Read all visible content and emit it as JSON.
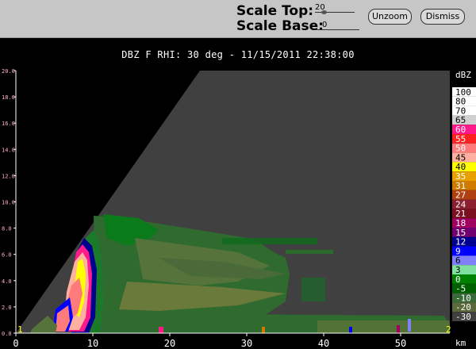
{
  "toolbar": {
    "scale_top_label": "Scale Top:",
    "scale_top_value": "20",
    "scale_base_label": "Scale Base:",
    "scale_base_value": "0",
    "unzoom_label": "Unzoom",
    "dismiss_label": "Dismiss"
  },
  "plot": {
    "title": "DBZ F  RHI: 30 deg  -  11/15/2011 22:38:00",
    "x_ticks": [
      "0",
      "10",
      "20",
      "30",
      "40",
      "50"
    ],
    "x_unit": "km",
    "y_ticks": [
      "0.0",
      "2.0",
      "4.0",
      "6.0",
      "8.0",
      "10.0",
      "12.0",
      "14.0",
      "16.0",
      "18.0",
      "20.0"
    ],
    "corner_left": "1",
    "corner_right": "2",
    "colors": {
      "background": "#404040",
      "blocked": "#000000",
      "axis_text": "#ffffff",
      "tick_y_text": "#ffb0c0"
    }
  },
  "colorbar": {
    "unit": "dBZ",
    "levels": [
      {
        "label": "100",
        "color": "#ffffff"
      },
      {
        "label": "80",
        "color": "#ffffff"
      },
      {
        "label": "70",
        "color": "#ffffff"
      },
      {
        "label": "65",
        "color": "#d0d0d0"
      },
      {
        "label": "60",
        "color": "#ff1a8c"
      },
      {
        "label": "55",
        "color": "#ff2020"
      },
      {
        "label": "50",
        "color": "#ff7a7a"
      },
      {
        "label": "45",
        "color": "#ffb0a0"
      },
      {
        "label": "40",
        "color": "#ffff00"
      },
      {
        "label": "35",
        "color": "#e8a000"
      },
      {
        "label": "31",
        "color": "#d07a00"
      },
      {
        "label": "27",
        "color": "#b04010"
      },
      {
        "label": "24",
        "color": "#8a2030"
      },
      {
        "label": "21",
        "color": "#7a1020"
      },
      {
        "label": "18",
        "color": "#a00060"
      },
      {
        "label": "15",
        "color": "#700070"
      },
      {
        "label": "12",
        "color": "#000090"
      },
      {
        "label": "9",
        "color": "#0000ff"
      },
      {
        "label": "6",
        "color": "#8080ff"
      },
      {
        "label": "3",
        "color": "#80e0a0"
      },
      {
        "label": "0",
        "color": "#008000"
      },
      {
        "label": "-5",
        "color": "#006000"
      },
      {
        "label": "-10",
        "color": "#3a6a3a"
      },
      {
        "label": "-20",
        "color": "#5a6a3a"
      },
      {
        "label": "-30",
        "color": "#404040"
      }
    ]
  }
}
